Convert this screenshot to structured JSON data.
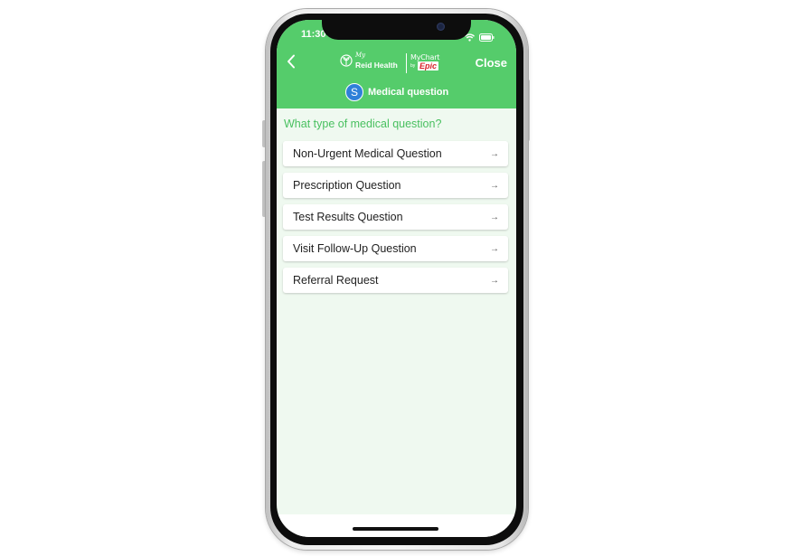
{
  "status_bar": {
    "time": "11:30"
  },
  "header": {
    "back_icon": "chevron-left-icon",
    "logo": {
      "my": "My",
      "reid_health": "Reid Health",
      "mychart": "MyChart",
      "by": "by",
      "epic": "Epic"
    },
    "close_label": "Close",
    "avatar_initial": "S",
    "subtitle": "Medical question"
  },
  "main": {
    "prompt": "What type of medical question?",
    "options": [
      {
        "label": "Non-Urgent Medical Question",
        "arrow": "→"
      },
      {
        "label": "Prescription Question",
        "arrow": "→"
      },
      {
        "label": "Test Results Question",
        "arrow": "→"
      },
      {
        "label": "Visit Follow-Up Question",
        "arrow": "→"
      },
      {
        "label": "Referral Request",
        "arrow": "→"
      }
    ]
  },
  "colors": {
    "header_green": "#55cc6b",
    "prompt_green": "#49c060",
    "content_bg": "#eff9f0",
    "avatar_blue": "#2f80d8",
    "epic_red": "#d8232a"
  }
}
